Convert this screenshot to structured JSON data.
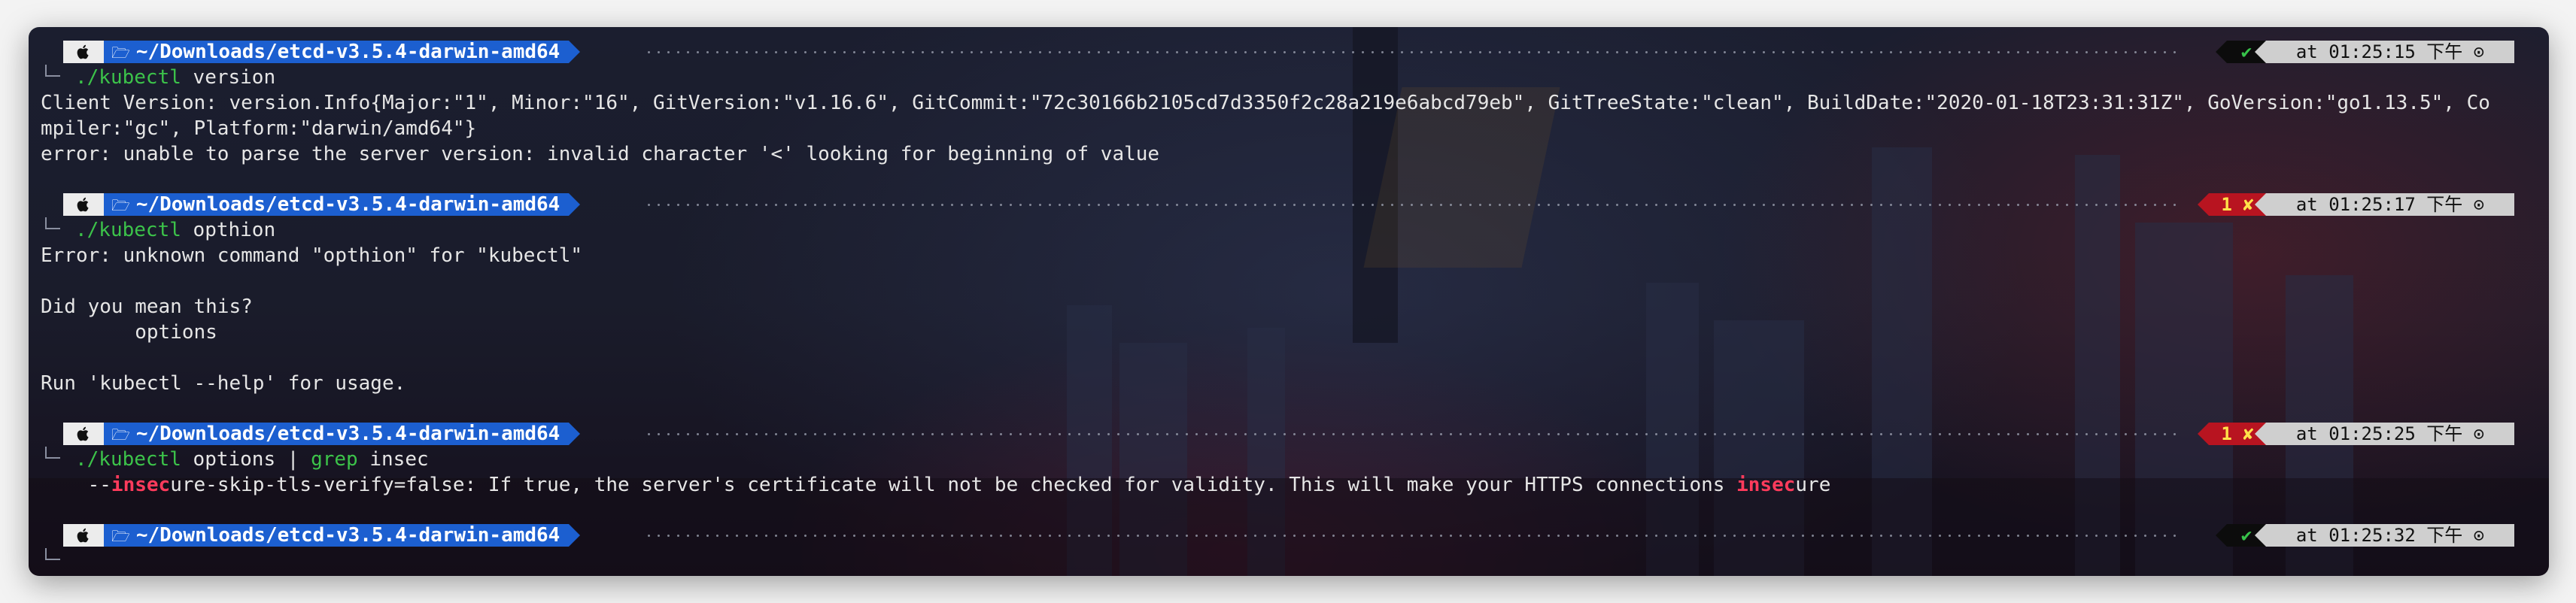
{
  "prompts": [
    {
      "apple_icon": "apple-logo-icon",
      "folder_icon": "folder-icon",
      "path": "~/Downloads/etcd-v3.5.4-darwin-amd64",
      "status": "✔",
      "status_type": "ok",
      "time": "at 01:25:15 下午 ⊙"
    },
    {
      "apple_icon": "apple-logo-icon",
      "folder_icon": "folder-icon",
      "path": "~/Downloads/etcd-v3.5.4-darwin-amd64",
      "status": "1 ✘",
      "status_type": "error",
      "time": "at 01:25:17 下午 ⊙"
    },
    {
      "apple_icon": "apple-logo-icon",
      "folder_icon": "folder-icon",
      "path": "~/Downloads/etcd-v3.5.4-darwin-amd64",
      "status": "1 ✘",
      "status_type": "error",
      "time": "at 01:25:25 下午 ⊙"
    },
    {
      "apple_icon": "apple-logo-icon",
      "folder_icon": "folder-icon",
      "path": "~/Downloads/etcd-v3.5.4-darwin-amd64",
      "status": "✔",
      "status_type": "ok",
      "time": "at 01:25:32 下午 ⊙"
    }
  ],
  "commands": {
    "c1": {
      "cmd": "./kubectl",
      "args": " version"
    },
    "c2": {
      "cmd": "./kubectl",
      "args": " opthion"
    },
    "c3": {
      "cmd": "./kubectl",
      "args": " options | ",
      "grep": "grep",
      "grep_args": " insec"
    }
  },
  "output": {
    "o1_line1": "Client Version: version.Info{Major:\"1\", Minor:\"16\", GitVersion:\"v1.16.6\", GitCommit:\"72c30166b2105cd7d3350f2c28a219e6abcd79eb\", GitTreeState:\"clean\", BuildDate:\"2020-01-18T23:31:31Z\", GoVersion:\"go1.13.5\", Co",
    "o1_line2": "mpiler:\"gc\", Platform:\"darwin/amd64\"}",
    "o1_line3": "error: unable to parse the server version: invalid character '<' looking for beginning of value",
    "o2_line1": "Error: unknown command \"opthion\" for \"kubectl\"",
    "o2_line2": "Did you mean this?",
    "o2_line3": "        options",
    "o2_line4": "Run 'kubectl --help' for usage.",
    "o3_pre": "    --",
    "o3_hl1": "insec",
    "o3_mid": "ure-skip-tls-verify=false: If true, the server's certificate will not be checked for validity. This will make your HTTPS connections ",
    "o3_hl2": "insec",
    "o3_post": "ure"
  },
  "colors": {
    "path_bg": "#1c5fd0",
    "ok": "#37c24a",
    "error_bg": "#b81420",
    "command": "#3cc34a",
    "highlight": "#ff3b5c"
  }
}
